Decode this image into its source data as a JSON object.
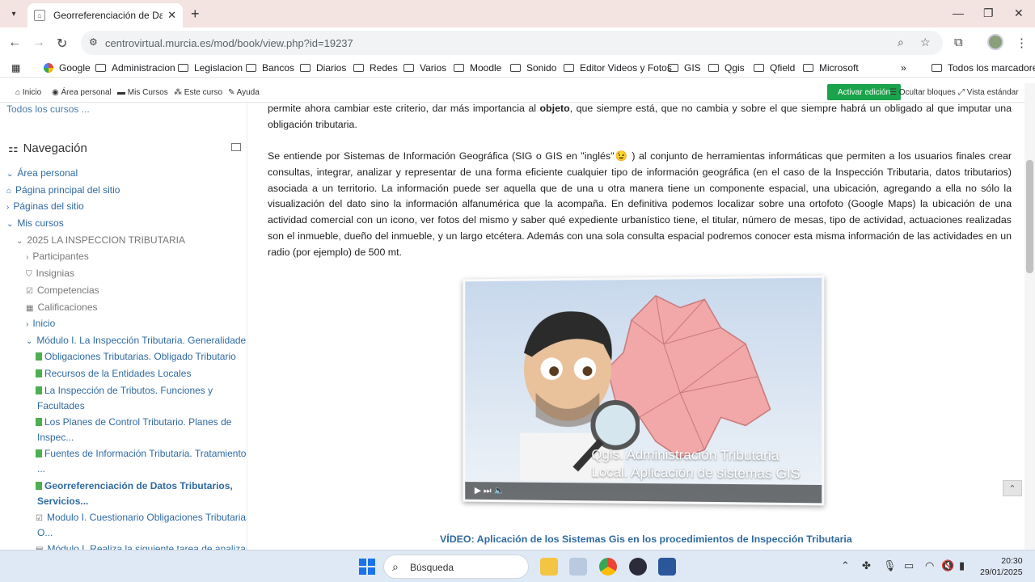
{
  "browser": {
    "tab_title": "Georreferenciación de Datos Tributarios",
    "url": "centrovirtual.murcia.es/mod/book/view.php?id=19237",
    "bookmarks": [
      "Google",
      "Administracion",
      "Legislacion",
      "Bancos",
      "Diarios",
      "Redes",
      "Varios",
      "Moodle",
      "Sonido",
      "Editor Videos y Fotos",
      "GIS",
      "Qgis",
      "Qfield",
      "Microsoft"
    ],
    "all_bookmarks": "Todos los marcadores"
  },
  "moodle_nav": {
    "inicio": "Inicio",
    "area_personal": "Área personal",
    "mis_cursos": "Mis Cursos",
    "este_curso": "Este curso",
    "ayuda": "Ayuda",
    "activar_edicion": "Activar edición",
    "ocultar_bloques": "Ocultar bloques",
    "vista_estandar": "Vista estándar"
  },
  "sidebar": {
    "all_courses": "Todos los cursos ...",
    "heading": "Navegación",
    "items": [
      "Área personal",
      "Página principal del sitio",
      "Páginas del sitio",
      "Mis cursos",
      "2025 LA INSPECCION TRIBUTARIA",
      "Participantes",
      "Insignias",
      "Competencias",
      "Calificaciones",
      "Inicio",
      "Módulo I. La Inspección Tributaria. Generalidades",
      "Obligaciones Tributarias. Obligado Tributario",
      "Recursos de la Entidades Locales",
      "La Inspección de Tributos. Funciones y",
      "Facultades",
      "Los Planes de Control Tributario. Planes de",
      "Inspec...",
      "Fuentes de Información Tributaria. Tratamiento de",
      "...",
      "Georreferenciación de Datos Tributarios,",
      "Servicios...",
      "Modulo I. Cuestionario Obligaciones Tributarias.",
      "O...",
      "Módulo I. Realiza la siguiente tarea de analizar"
    ]
  },
  "content": {
    "para1_a": "permite ahora cambiar este criterio, dar más importancia al ",
    "para1_bold": "objeto",
    "para1_b": ", que siempre está, que no cambia y sobre el que siempre habrá un obligado al que imputar una obligación tributaria.",
    "para2": "Se entiende por Sistemas de Información Geográfica (SIG o GIS en \"inglés\"😉 ) al conjunto de herramientas informáticas que permiten a los usuarios finales crear consultas, integrar, analizar y representar de una forma eficiente cualquier tipo de información geográfica (en el caso de la Inspección Tributaria, datos tributarios) asociada a un territorio. La información puede ser aquella que de una u otra manera tiene un componente espacial, una ubicación,  agregando a ella no sólo la visualización del dato sino la información alfanumérica que la acompaña. En definitiva podemos  localizar sobre una ortofoto (Google Maps)  la ubicación de una actividad comercial con un icono, ver fotos del mismo y saber qué expediente urbanístico tiene, el titular, número de mesas, tipo de actividad, actuaciones realizadas son el inmueble, dueño del inmueble, y un largo etcétera. Además con una sola consulta espacial podremos conocer esta misma información de las actividades en un radio (por ejemplo) de 500 mt.",
    "video_caption_line1": "Qgis. Administración Tributaria",
    "video_caption_line2": "Local. Aplicación de sistemas GIS",
    "video_title": "VÍDEO: Aplicación de los Sistemas Gis en los procedimientos de Inspección Tributaria"
  },
  "taskbar": {
    "search": "Búsqueda",
    "time": "20:30",
    "date": "29/01/2025"
  }
}
